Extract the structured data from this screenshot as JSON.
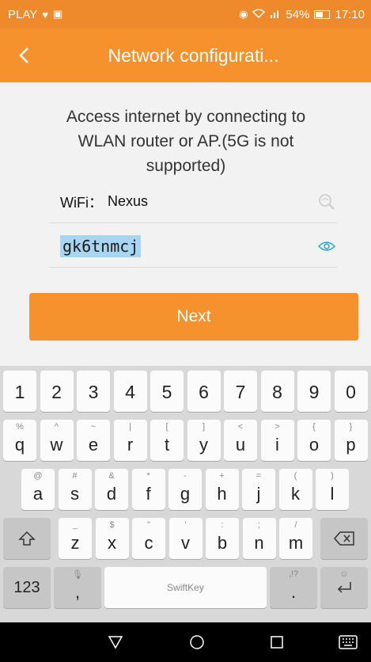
{
  "status_bar": {
    "carrier": "PLAY",
    "battery": "54%",
    "time": "17:10",
    "icons": [
      "heart-icon",
      "notification-icon",
      "eye-icon",
      "wifi-icon",
      "signal-icon",
      "battery-icon"
    ]
  },
  "app_bar": {
    "back_icon": "chevron-left-icon",
    "title": "Network configurati..."
  },
  "main": {
    "description": "Access internet by connecting to WLAN router or AP.(5G is not supported)",
    "wifi_label": "WiFi：",
    "wifi_name": "Nexus",
    "wifi_search_icon": "wifi-search-icon",
    "password_value": "gk6tnmcj",
    "password_toggle_icon": "eye-icon",
    "next_label": "Next"
  },
  "keyboard": {
    "numbers": [
      "1",
      "2",
      "3",
      "4",
      "5",
      "6",
      "7",
      "8",
      "9",
      "0"
    ],
    "row1": [
      {
        "main": "q",
        "alt": "%"
      },
      {
        "main": "w",
        "alt": "^"
      },
      {
        "main": "e",
        "alt": "~"
      },
      {
        "main": "r",
        "alt": "|"
      },
      {
        "main": "t",
        "alt": "["
      },
      {
        "main": "y",
        "alt": "]"
      },
      {
        "main": "u",
        "alt": "<"
      },
      {
        "main": "i",
        "alt": ">"
      },
      {
        "main": "o",
        "alt": "{"
      },
      {
        "main": "p",
        "alt": "}"
      }
    ],
    "row2": [
      {
        "main": "a",
        "alt": "@"
      },
      {
        "main": "s",
        "alt": "#"
      },
      {
        "main": "d",
        "alt": "&"
      },
      {
        "main": "f",
        "alt": "*"
      },
      {
        "main": "g",
        "alt": "-"
      },
      {
        "main": "h",
        "alt": "+"
      },
      {
        "main": "j",
        "alt": "="
      },
      {
        "main": "k",
        "alt": "("
      },
      {
        "main": "l",
        "alt": ")"
      }
    ],
    "row3": [
      {
        "main": "z",
        "alt": "_"
      },
      {
        "main": "x",
        "alt": "$"
      },
      {
        "main": "c",
        "alt": "\""
      },
      {
        "main": "v",
        "alt": "'"
      },
      {
        "main": "b",
        "alt": ":"
      },
      {
        "main": "n",
        "alt": ";"
      },
      {
        "main": "m",
        "alt": "/"
      }
    ],
    "shift_icon": "shift-icon",
    "backspace_icon": "backspace-icon",
    "symbols_label": "123",
    "comma_label": ",",
    "comma_alt_icon": "microphone-icon",
    "space_label": "SwiftKey",
    "period_label": ".",
    "period_alt": ",!?",
    "enter_icon": "enter-icon",
    "enter_alt_icon": "emoji-icon"
  },
  "nav_bar": {
    "back_icon": "triangle-back-icon",
    "home_icon": "circle-home-icon",
    "recents_icon": "square-recents-icon",
    "keyboard_icon": "keyboard-icon"
  }
}
